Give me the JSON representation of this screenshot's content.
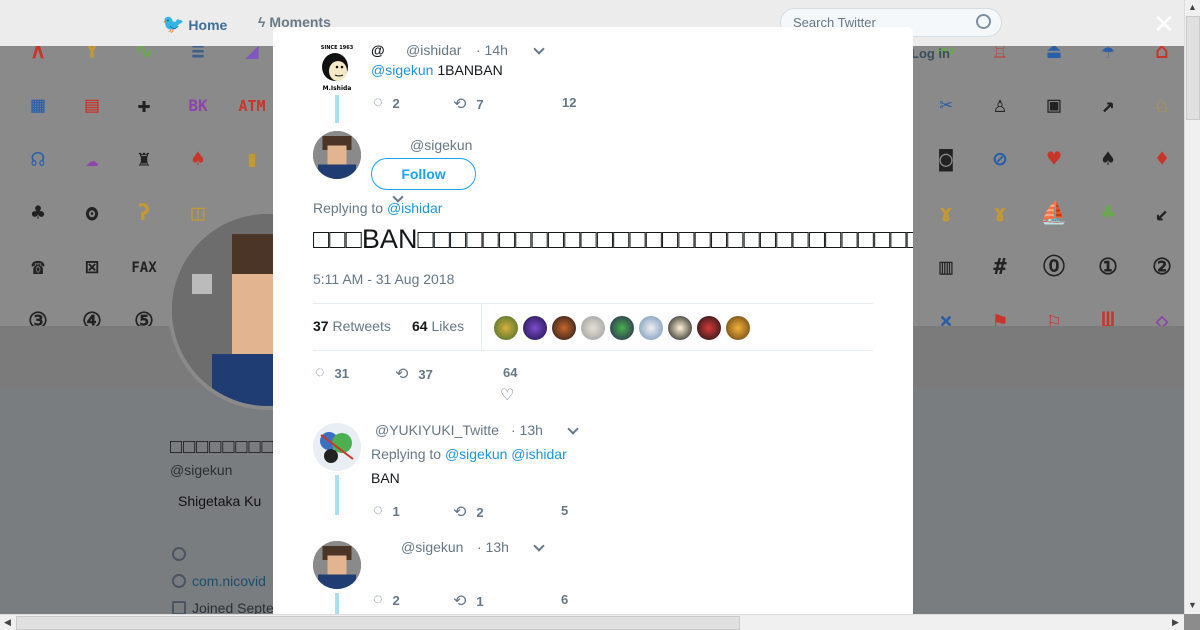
{
  "nav": {
    "home_label": "Home",
    "moments_label": "Moments",
    "search_placeholder": "Search Twitter",
    "login_label": "Log in"
  },
  "profile": {
    "name": "□□□□□□□□□",
    "handle": "@sigekun",
    "bio": "Shigetaka Ku",
    "link": "com.nicovid",
    "joined": "Joined Septe"
  },
  "tweets": [
    {
      "name": "@",
      "handle": "@ishidar",
      "time": "· 14h",
      "mention": "@sigekun",
      "text": "1BANBAN",
      "replies": "2",
      "retweets": "7",
      "likes": "12"
    },
    {
      "handle": "@sigekun",
      "follow_label": "Follow",
      "replying_prefix": "Replying to",
      "replying_to": "@ishidar",
      "text": "□□□BAN□□□□□□□□□□□□□□□□□□□□□□□□□□□□□□□□□□□□□□□□□□□□□□□□□",
      "timestamp": "5:11 AM - 31 Aug 2018",
      "retweets_count": "37",
      "retweets_label": "Retweets",
      "likes_count": "64",
      "likes_label": "Likes",
      "replies": "31",
      "retweets": "37",
      "likes": "64"
    },
    {
      "handle": "@YUKIYUKI_Twitte",
      "time": "· 13h",
      "replying_prefix": "Replying to",
      "mention1": "@sigekun",
      "mention2": "@ishidar",
      "text": "BAN",
      "replies": "1",
      "retweets": "2",
      "likes": "5"
    },
    {
      "handle": "@sigekun",
      "time": "· 13h",
      "replies": "2",
      "retweets": "1",
      "likes": "6"
    }
  ],
  "icons": {
    "close": "close-icon",
    "reply": "reply-icon",
    "retweet": "retweet-icon",
    "like": "heart-icon"
  },
  "colors": {
    "accent": "#1da1f2",
    "link": "#1b95e0",
    "thread": "#a9e0ef",
    "muted": "#657786"
  }
}
